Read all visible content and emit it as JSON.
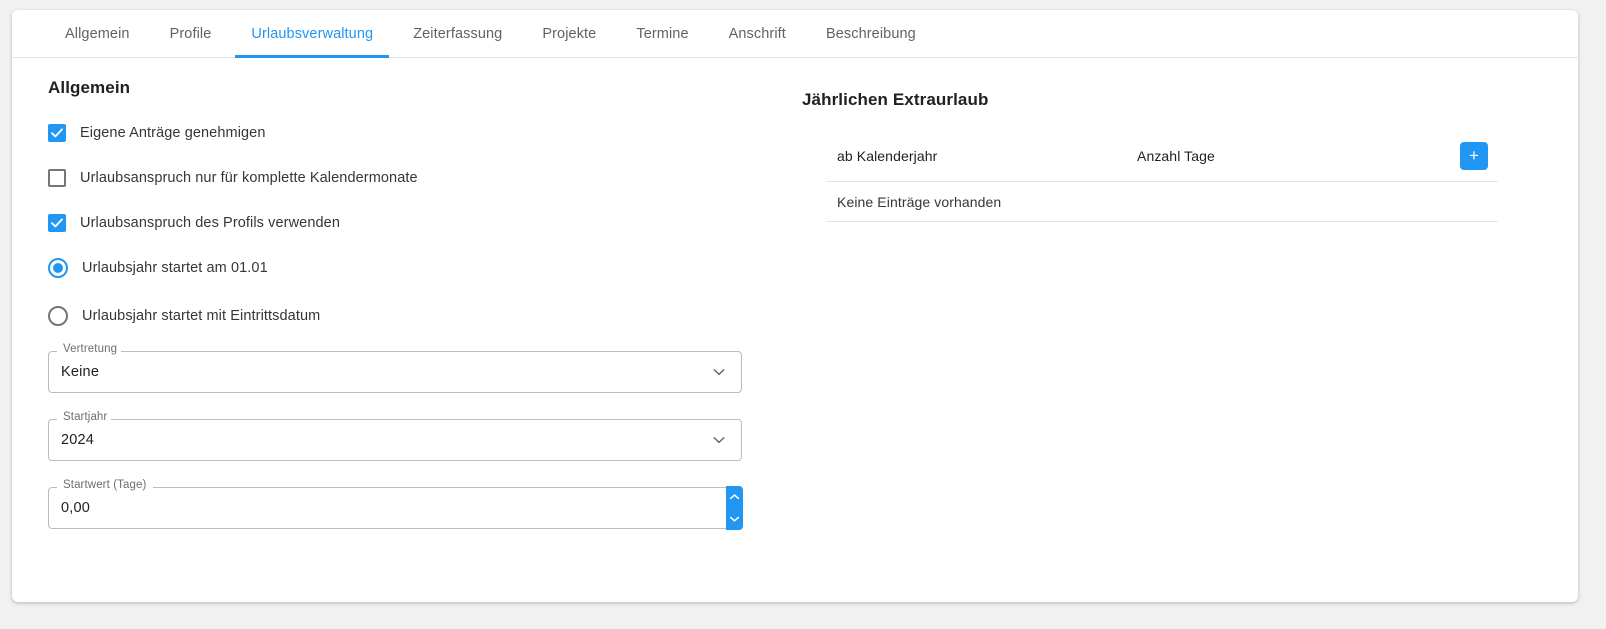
{
  "tabs": [
    {
      "label": "Allgemein",
      "active": false
    },
    {
      "label": "Profile",
      "active": false
    },
    {
      "label": "Urlaubsverwaltung",
      "active": true
    },
    {
      "label": "Zeiterfassung",
      "active": false
    },
    {
      "label": "Projekte",
      "active": false
    },
    {
      "label": "Termine",
      "active": false
    },
    {
      "label": "Anschrift",
      "active": false
    },
    {
      "label": "Beschreibung",
      "active": false
    }
  ],
  "left": {
    "title": "Allgemein",
    "checkboxes": [
      {
        "label": "Eigene Anträge genehmigen",
        "checked": true
      },
      {
        "label": "Urlaubsanspruch nur für komplette Kalendermonate",
        "checked": false
      },
      {
        "label": "Urlaubsanspruch des Profils verwenden",
        "checked": true
      }
    ],
    "radios": [
      {
        "label": "Urlaubsjahr startet am 01.01",
        "selected": true
      },
      {
        "label": "Urlaubsjahr startet mit Eintrittsdatum",
        "selected": false
      }
    ],
    "fields": {
      "vertretung": {
        "label": "Vertretung",
        "value": "Keine"
      },
      "startjahr": {
        "label": "Startjahr",
        "value": "2024"
      },
      "startwert": {
        "label": "Startwert (Tage)",
        "value": "0,00"
      }
    }
  },
  "right": {
    "title": "Jährlichen Extraurlaub",
    "table": {
      "columns": [
        "ab Kalenderjahr",
        "Anzahl Tage"
      ],
      "add_label": "+",
      "empty_text": "Keine Einträge vorhanden",
      "rows": []
    }
  },
  "colors": {
    "accent": "#2196f3",
    "text": "#202124",
    "muted": "#5f6368",
    "border": "#e4e4e4",
    "page_bg": "#f1f1f1"
  }
}
